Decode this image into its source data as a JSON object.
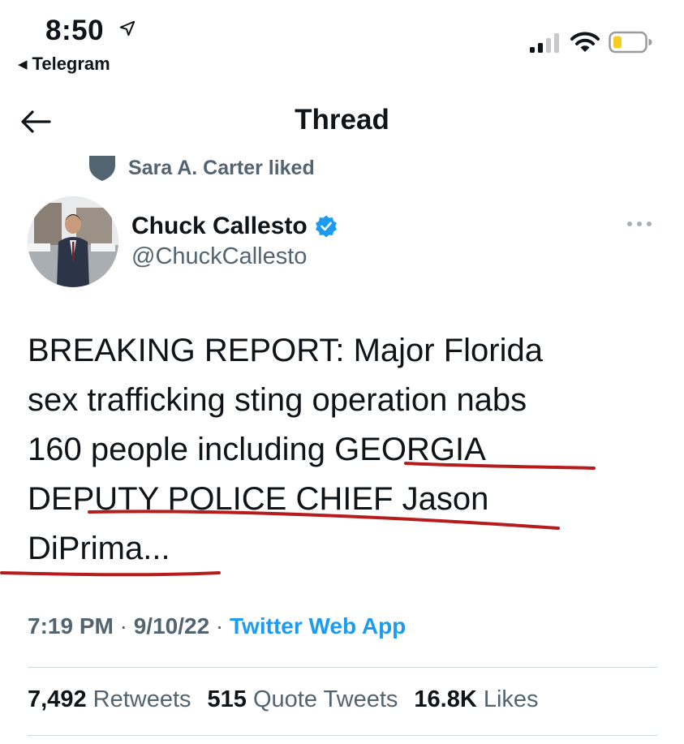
{
  "status_bar": {
    "time": "8:50",
    "back_app": "Telegram"
  },
  "header": {
    "title": "Thread"
  },
  "social_context": {
    "text": "Sara A. Carter liked"
  },
  "author": {
    "name": "Chuck Callesto",
    "handle": "@ChuckCallesto",
    "verified": true
  },
  "tweet": {
    "lines": [
      "BREAKING REPORT: Major Florida",
      "sex trafficking sting operation nabs",
      "160 people including GEORGIA",
      "DEPUTY POLICE CHIEF Jason",
      "DiPrima..."
    ],
    "time": "7:19 PM",
    "date": "9/10/22",
    "source": "Twitter Web App"
  },
  "stats": {
    "retweets_count": "7,492",
    "retweets_label": "Retweets",
    "quotes_count": "515",
    "quotes_label": "Quote Tweets",
    "likes_count": "16.8K",
    "likes_label": "Likes"
  },
  "colors": {
    "accent": "#1d9bf0",
    "secondary_text": "#536471",
    "annotation": "#b71c1c"
  },
  "icons": {
    "status": [
      "location-arrow-icon",
      "cellular-signal-icon",
      "wifi-icon",
      "battery-icon"
    ],
    "header": [
      "back-arrow-icon"
    ],
    "tweet": [
      "shield-icon",
      "verified-badge-icon",
      "more-options-icon"
    ]
  }
}
